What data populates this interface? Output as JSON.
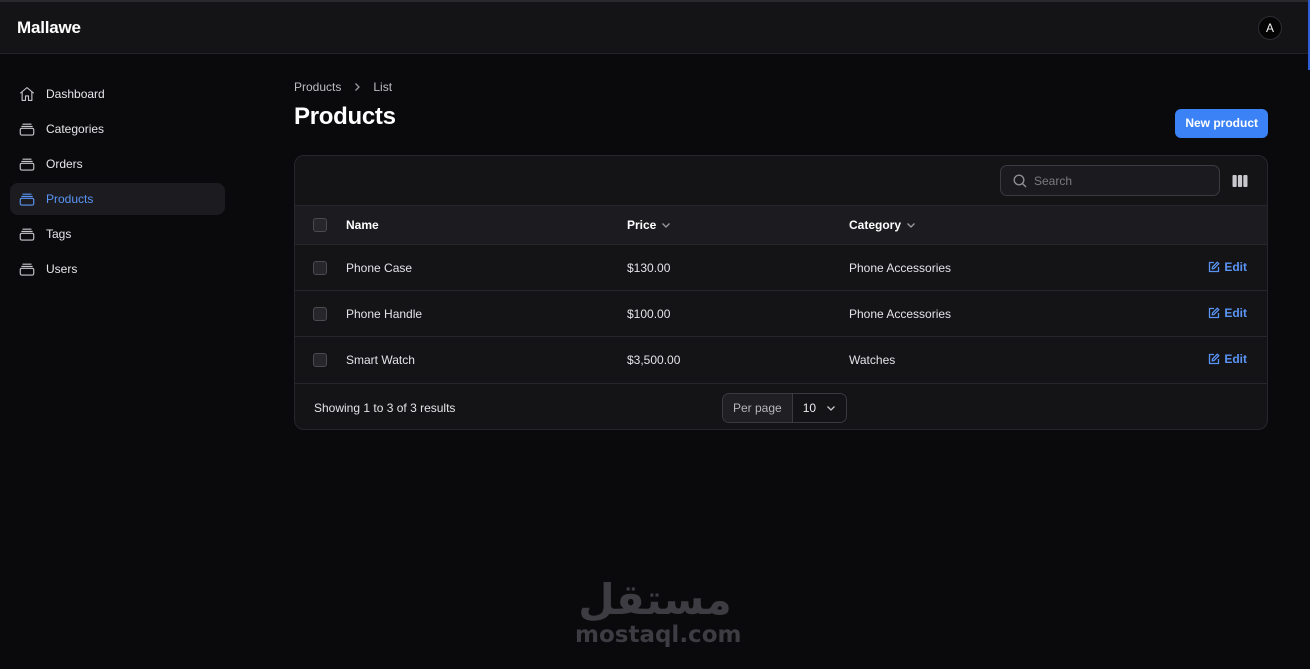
{
  "app": {
    "brand": "Mallawe",
    "avatar_initial": "A"
  },
  "sidebar": {
    "items": [
      {
        "label": "Dashboard",
        "icon": "home-icon",
        "active": false
      },
      {
        "label": "Categories",
        "icon": "collection-icon",
        "active": false
      },
      {
        "label": "Orders",
        "icon": "collection-icon",
        "active": false
      },
      {
        "label": "Products",
        "icon": "collection-icon",
        "active": true
      },
      {
        "label": "Tags",
        "icon": "collection-icon",
        "active": false
      },
      {
        "label": "Users",
        "icon": "collection-icon",
        "active": false
      }
    ]
  },
  "breadcrumb": {
    "parent": "Products",
    "current": "List"
  },
  "page": {
    "title": "Products",
    "new_button": "New product"
  },
  "table": {
    "search_placeholder": "Search",
    "columns": {
      "name": "Name",
      "price": "Price",
      "category": "Category"
    },
    "rows": [
      {
        "name": "Phone Case",
        "price": "$130.00",
        "category": "Phone Accessories",
        "action": "Edit"
      },
      {
        "name": "Phone Handle",
        "price": "$100.00",
        "category": "Phone Accessories",
        "action": "Edit"
      },
      {
        "name": "Smart Watch",
        "price": "$3,500.00",
        "category": "Watches",
        "action": "Edit"
      }
    ],
    "footer": {
      "results": "Showing 1 to 3 of 3 results",
      "per_page_label": "Per page",
      "per_page_value": "10"
    }
  },
  "watermark": {
    "arabic": "مستقل",
    "latin": "mostaql.com"
  },
  "colors": {
    "accent": "#3b82f6",
    "link": "#5a95f5",
    "background": "#0a0a0c",
    "surface": "#141417"
  }
}
